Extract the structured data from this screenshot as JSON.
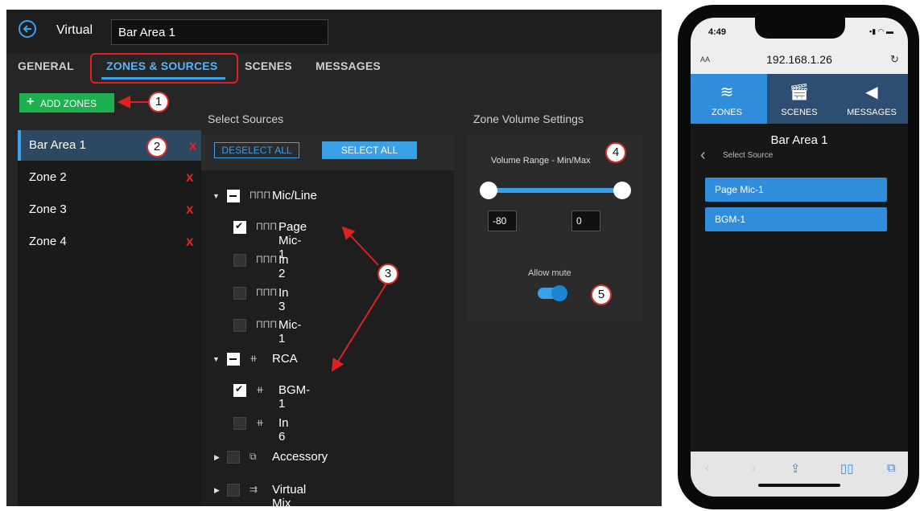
{
  "desktop": {
    "title": "Virtual",
    "zone_name": "Bar Area 1",
    "tabs": [
      {
        "label": "GENERAL"
      },
      {
        "label": "ZONES & SOURCES",
        "active": true
      },
      {
        "label": "SCENES"
      },
      {
        "label": "MESSAGES"
      }
    ],
    "add_zones_label": "ADD ZONES",
    "zones": [
      {
        "label": "Bar Area 1",
        "selected": true,
        "remove": "X"
      },
      {
        "label": "Zone 2",
        "remove": "X"
      },
      {
        "label": "Zone 3",
        "remove": "X"
      },
      {
        "label": "Zone 4",
        "remove": "X"
      }
    ],
    "select_sources_title": "Select Sources",
    "deselect_all_label": "DESELECT ALL",
    "select_all_label": "SELECT ALL",
    "sources": [
      {
        "label": "Mic/Line",
        "level": "group",
        "expanded": true,
        "state": "partial",
        "icon": "mic-line-icon"
      },
      {
        "label": "Page Mic-1",
        "level": "item",
        "state": "checked",
        "icon": "mic-line-icon"
      },
      {
        "label": "In 2",
        "level": "item",
        "state": "unchecked",
        "icon": "mic-line-icon"
      },
      {
        "label": "In 3",
        "level": "item",
        "state": "unchecked",
        "icon": "mic-line-icon"
      },
      {
        "label": "Mic-1",
        "level": "item",
        "state": "unchecked",
        "icon": "mic-line-icon"
      },
      {
        "label": "RCA",
        "level": "group",
        "expanded": true,
        "state": "partial",
        "icon": "rca-icon"
      },
      {
        "label": "BGM-1",
        "level": "item",
        "state": "checked",
        "icon": "rca-icon"
      },
      {
        "label": "In 6",
        "level": "item",
        "state": "unchecked",
        "icon": "rca-icon"
      },
      {
        "label": "Accessory",
        "level": "group",
        "expanded": false,
        "state": "unchecked",
        "icon": "accessory-icon"
      },
      {
        "label": "Virtual Mix",
        "level": "group",
        "expanded": false,
        "state": "unchecked",
        "icon": "virtual-mix-icon"
      }
    ],
    "zone_volume_title": "Zone Volume Settings",
    "volume_range_label": "Volume Range - Min/Max",
    "volume_min": "-80",
    "volume_max": "0",
    "allow_mute_label": "Allow mute",
    "allow_mute": true
  },
  "callouts": [
    "1",
    "2",
    "3",
    "4",
    "5"
  ],
  "phone": {
    "time": "4:49",
    "url": "192.168.1.26",
    "aa_label": "AA",
    "nav": [
      {
        "label": "ZONES",
        "icon": "layers-icon",
        "active": true
      },
      {
        "label": "SCENES",
        "icon": "clapperboard-icon"
      },
      {
        "label": "MESSAGES",
        "icon": "megaphone-icon"
      }
    ],
    "zone_title": "Bar Area 1",
    "select_source_label": "Select Source",
    "sources": [
      "Page Mic-1",
      "BGM-1"
    ]
  },
  "colors": {
    "accent": "#3aa0e8",
    "add_green": "#1bb14e",
    "remove_red": "#e22222",
    "callout_red": "#e02020"
  }
}
